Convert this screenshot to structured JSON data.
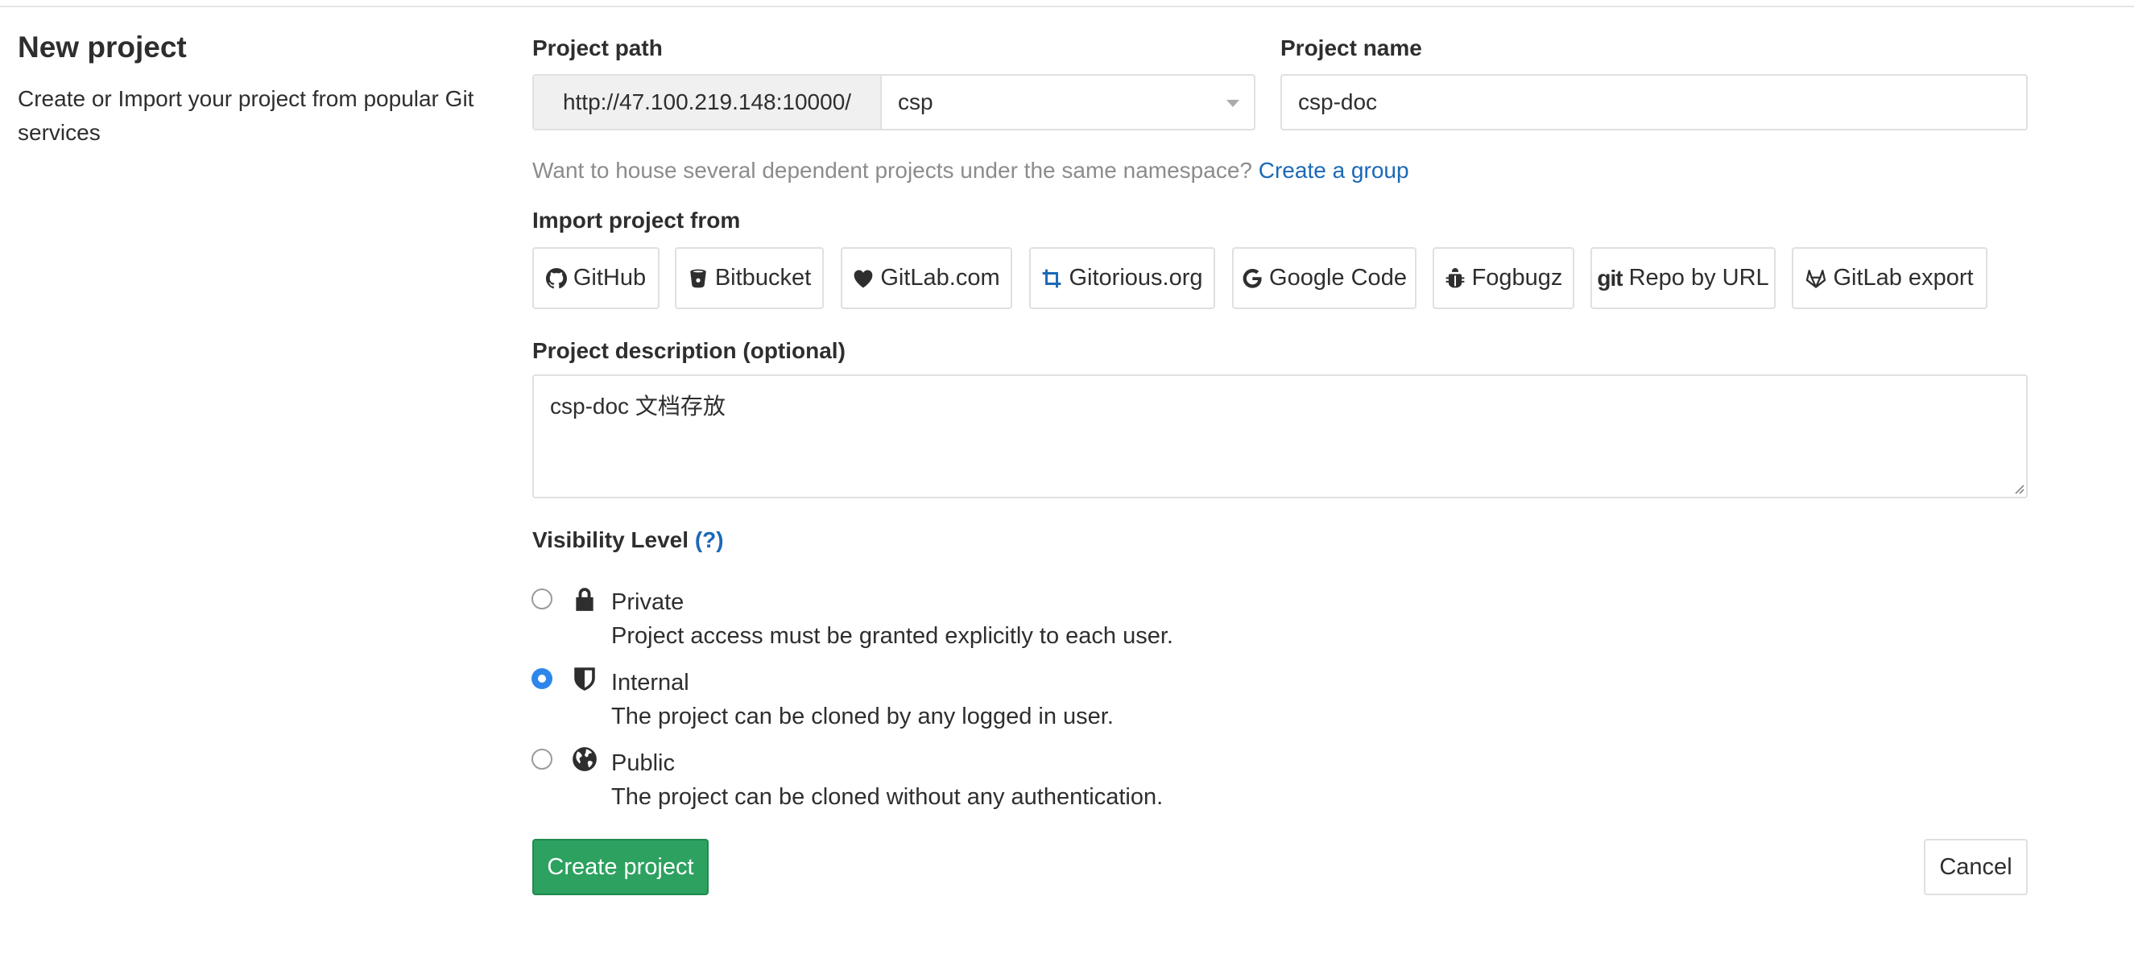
{
  "header": {
    "title": "New project",
    "subtitle": "Create or Import your project from popular Git services"
  },
  "project_path": {
    "label": "Project path",
    "prefix": "http://47.100.219.148:10000/",
    "namespace": "csp"
  },
  "project_name": {
    "label": "Project name",
    "value": "csp-doc"
  },
  "group_hint": {
    "text": "Want to house several dependent projects under the same namespace?",
    "link": "Create a group"
  },
  "import": {
    "label": "Import project from",
    "sources": [
      {
        "label": "GitHub",
        "icon": "github-icon"
      },
      {
        "label": "Bitbucket",
        "icon": "bitbucket-icon"
      },
      {
        "label": "GitLab.com",
        "icon": "heart-icon"
      },
      {
        "label": "Gitorious.org",
        "icon": "gitorious-icon"
      },
      {
        "label": "Google Code",
        "icon": "google-icon"
      },
      {
        "label": "Fogbugz",
        "icon": "bug-icon"
      },
      {
        "label": "Repo by URL",
        "icon": "git-icon",
        "icon_text": "git"
      },
      {
        "label": "GitLab export",
        "icon": "gitlab-icon"
      }
    ]
  },
  "description": {
    "label": "Project description (optional)",
    "value": "csp-doc 文档存放"
  },
  "visibility": {
    "label": "Visibility Level",
    "help": "(?)",
    "selected": "Internal",
    "options": [
      {
        "title": "Private",
        "desc": "Project access must be granted explicitly to each user.",
        "icon": "lock-icon"
      },
      {
        "title": "Internal",
        "desc": "The project can be cloned by any logged in user.",
        "icon": "shield-icon"
      },
      {
        "title": "Public",
        "desc": "The project can be cloned without any authentication.",
        "icon": "globe-icon"
      }
    ]
  },
  "actions": {
    "create": "Create project",
    "cancel": "Cancel"
  },
  "colors": {
    "primary_green": "#2da160",
    "link_blue": "#1b69b6",
    "radio_blue": "#2e86ea"
  }
}
